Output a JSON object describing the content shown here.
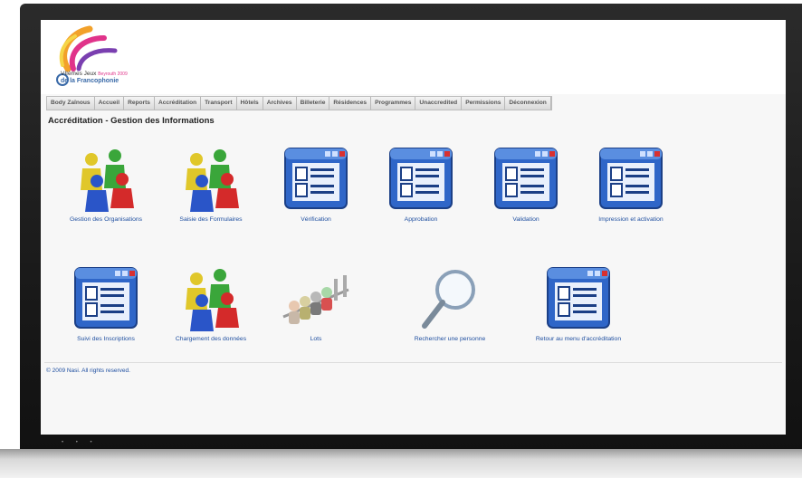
{
  "logo": {
    "line1": "VIIèmes Jeux",
    "line2": "de la Francophonie",
    "accent": "Beyrouth 2009"
  },
  "nav": [
    "Body Zaïnous",
    "Accueil",
    "Reports",
    "Accréditation",
    "Transport",
    "Hôtels",
    "Archives",
    "Billeterie",
    "Résidences",
    "Programmes",
    "Unaccredited",
    "Permissions",
    "Déconnexion"
  ],
  "page_title": "Accréditation - Gestion des Informations",
  "tiles_row1": [
    {
      "label": "Gestion des Organisations",
      "icon": "people-icon"
    },
    {
      "label": "Saisie des Formulaires",
      "icon": "people-icon"
    },
    {
      "label": "Vérification",
      "icon": "form-window-icon"
    },
    {
      "label": "Approbation",
      "icon": "form-window-icon"
    },
    {
      "label": "Validation",
      "icon": "form-window-icon"
    },
    {
      "label": "Impression et activation",
      "icon": "form-window-icon"
    }
  ],
  "tiles_row2": [
    {
      "label": "Suivi des Inscriptions",
      "icon": "form-window-icon"
    },
    {
      "label": "Chargement des données",
      "icon": "people-icon"
    },
    {
      "label": "Lots",
      "icon": "queue-icon"
    },
    {
      "label": "Rechercher une personne",
      "icon": "magnifier-icon"
    },
    {
      "label": "Retour au menu d'accréditation",
      "icon": "form-window-icon"
    }
  ],
  "copyright": "© 2009 Nasi. All rights reserved.",
  "colors": {
    "link": "#1f4fa0",
    "window_blue": "#2f66c8",
    "close_red": "#d93030"
  }
}
